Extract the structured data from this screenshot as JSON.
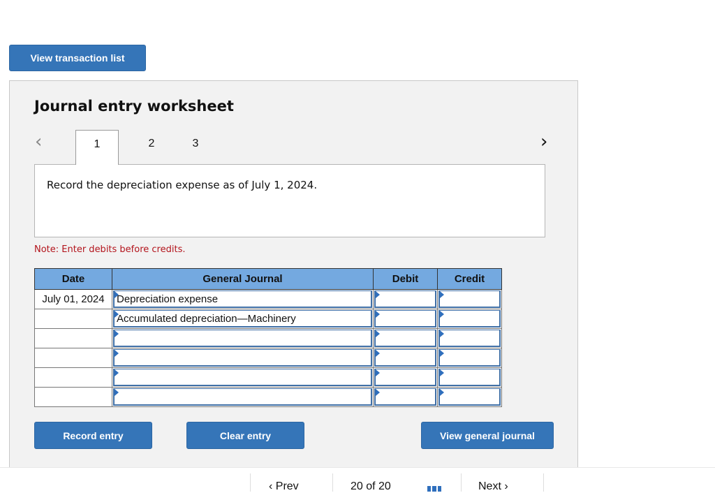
{
  "toolbar": {
    "view_transaction_list_label": "View transaction list"
  },
  "worksheet": {
    "title": "Journal entry worksheet",
    "nav": {
      "prev_icon": "‹",
      "next_icon": "›"
    },
    "tabs": [
      {
        "label": "1",
        "active": true
      },
      {
        "label": "2",
        "active": false
      },
      {
        "label": "3",
        "active": false
      }
    ],
    "question": "Record the depreciation expense as of July 1, 2024.",
    "note": "Note: Enter debits before credits."
  },
  "journal": {
    "headers": {
      "date": "Date",
      "general_journal": "General Journal",
      "debit": "Debit",
      "credit": "Credit"
    },
    "rows": [
      {
        "date": "July 01, 2024",
        "account": "Depreciation expense",
        "debit": "",
        "credit": ""
      },
      {
        "date": "",
        "account": "Accumulated depreciation—Machinery",
        "debit": "",
        "credit": ""
      },
      {
        "date": "",
        "account": "",
        "debit": "",
        "credit": ""
      },
      {
        "date": "",
        "account": "",
        "debit": "",
        "credit": ""
      },
      {
        "date": "",
        "account": "",
        "debit": "",
        "credit": ""
      },
      {
        "date": "",
        "account": "",
        "debit": "",
        "credit": ""
      }
    ]
  },
  "actions": {
    "record_entry_label": "Record entry",
    "clear_entry_label": "Clear entry",
    "view_general_journal_label": "View general journal"
  },
  "footer": {
    "prev_label": "‹ Prev",
    "page_indicator": "20 of 20",
    "next_label": "Next ›"
  },
  "colors": {
    "button": "#3575b8",
    "header": "#74a9e0",
    "note": "#b3141c",
    "panel": "#f2f2f2"
  }
}
